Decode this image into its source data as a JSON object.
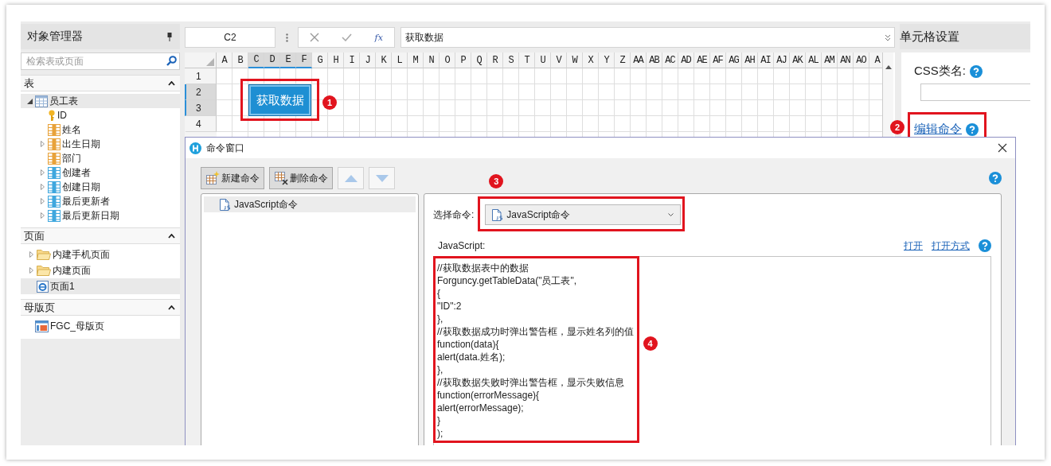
{
  "object_manager": {
    "title": "对象管理器",
    "search": {
      "placeholder": "检索表或页面"
    },
    "sections": [
      {
        "title": "表",
        "expanded": true,
        "items": [
          {
            "label": "员工表",
            "kind": "table",
            "expanded": true,
            "selected": true,
            "children": [
              {
                "label": "ID",
                "kind": "key",
                "selected": false
              },
              {
                "label": "姓名",
                "kind": "field",
                "selected": false
              },
              {
                "label": "出生日期",
                "kind": "field",
                "expanded": false,
                "selected": false
              },
              {
                "label": "部门",
                "kind": "field",
                "selected": false
              },
              {
                "label": "创建者",
                "kind": "system_field",
                "expanded": false,
                "selected": false
              },
              {
                "label": "创建日期",
                "kind": "system_field",
                "expanded": false,
                "selected": false
              },
              {
                "label": "最后更新者",
                "kind": "system_field",
                "expanded": false,
                "selected": false
              },
              {
                "label": "最后更新日期",
                "kind": "system_field",
                "expanded": false,
                "selected": false
              }
            ]
          }
        ]
      },
      {
        "title": "页面",
        "expanded": true,
        "items": [
          {
            "label": "内建手机页面",
            "kind": "folder",
            "expanded": false,
            "selected": false
          },
          {
            "label": "内建页面",
            "kind": "folder",
            "expanded": false,
            "selected": false
          },
          {
            "label": "页面1",
            "kind": "page",
            "selected": true
          }
        ]
      },
      {
        "title": "母版页",
        "expanded": true,
        "items": [
          {
            "label": "FGC_母版页",
            "kind": "master",
            "selected": false
          }
        ]
      }
    ]
  },
  "formula_bar": {
    "cell_reference": "C2",
    "function_label": "fx",
    "formula": "获取数据"
  },
  "sheet": {
    "columns": [
      {
        "label": "A",
        "selected": false
      },
      {
        "label": "B",
        "selected": false
      },
      {
        "label": "C",
        "selected": true
      },
      {
        "label": "D",
        "selected": true
      },
      {
        "label": "E",
        "selected": true
      },
      {
        "label": "F",
        "selected": true
      },
      {
        "label": "G",
        "selected": false
      },
      {
        "label": "H",
        "selected": false
      },
      {
        "label": "I",
        "selected": false
      },
      {
        "label": "J",
        "selected": false
      },
      {
        "label": "K",
        "selected": false
      },
      {
        "label": "L",
        "selected": false
      },
      {
        "label": "M",
        "selected": false
      },
      {
        "label": "N",
        "selected": false
      },
      {
        "label": "O",
        "selected": false
      },
      {
        "label": "P",
        "selected": false
      },
      {
        "label": "Q",
        "selected": false
      },
      {
        "label": "R",
        "selected": false
      },
      {
        "label": "S",
        "selected": false
      },
      {
        "label": "T",
        "selected": false
      },
      {
        "label": "U",
        "selected": false
      },
      {
        "label": "V",
        "selected": false
      },
      {
        "label": "W",
        "selected": false
      },
      {
        "label": "X",
        "selected": false
      },
      {
        "label": "Y",
        "selected": false
      },
      {
        "label": "Z",
        "selected": false
      },
      {
        "label": "AA",
        "selected": false
      },
      {
        "label": "AB",
        "selected": false
      },
      {
        "label": "AC",
        "selected": false
      },
      {
        "label": "AD",
        "selected": false
      },
      {
        "label": "AE",
        "selected": false
      },
      {
        "label": "AF",
        "selected": false
      },
      {
        "label": "AG",
        "selected": false
      },
      {
        "label": "AH",
        "selected": false
      },
      {
        "label": "AI",
        "selected": false
      },
      {
        "label": "AJ",
        "selected": false
      },
      {
        "label": "AK",
        "selected": false
      },
      {
        "label": "AL",
        "selected": false
      },
      {
        "label": "AM",
        "selected": false
      },
      {
        "label": "AN",
        "selected": false
      },
      {
        "label": "AO",
        "selected": false
      },
      {
        "label": "A",
        "selected": false
      }
    ],
    "rows": [
      {
        "label": "1",
        "selected": false
      },
      {
        "label": "2",
        "selected": true
      },
      {
        "label": "3",
        "selected": true
      },
      {
        "label": "4",
        "selected": false
      }
    ],
    "button": {
      "label": "获取数据",
      "marker": "1"
    }
  },
  "cell_settings": {
    "title": "单元格设置",
    "css_class_label": "CSS类名:",
    "edit_command_link": "编辑命令",
    "marker": "2"
  },
  "command_window": {
    "title": "命令窗口",
    "toolbar": [
      {
        "kind": "new",
        "label": "新建命令",
        "disabled": false
      },
      {
        "kind": "delete",
        "label": "删除命令",
        "disabled": false
      },
      {
        "kind": "up",
        "disabled": true
      },
      {
        "kind": "down",
        "disabled": true
      }
    ],
    "commands": [
      {
        "label": "JavaScript命令",
        "selected": true
      }
    ],
    "select_label": "选择命令:",
    "selected_command": "JavaScript命令",
    "select_marker": "3",
    "script_label": "JavaScript:",
    "links": [
      "打开",
      "打开方式"
    ],
    "code_lines": [
      "//获取数据表中的数据",
      "Forguncy.getTableData(\"员工表\",",
      "{",
      "\"ID\":2",
      "},",
      "//获取数据成功时弹出警告框，显示姓名列的值",
      "function(data){",
      "alert(data.姓名);",
      "},",
      "//获取数据失败时弹出警告框，显示失败信息",
      "function(errorMessage){",
      "alert(errorMessage);",
      "}",
      ");"
    ],
    "code_marker": "4"
  }
}
